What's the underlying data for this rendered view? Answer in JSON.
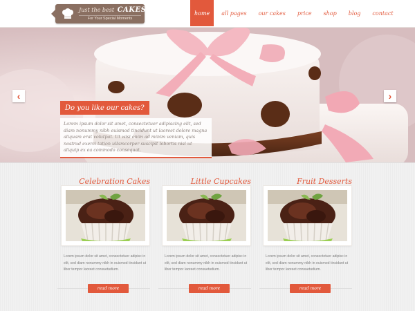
{
  "header": {
    "logo": {
      "tagline_top": "Just the best",
      "brand": "CAKES",
      "tagline_bottom": "For Your Special Moments"
    },
    "nav": [
      {
        "label": "home",
        "active": true
      },
      {
        "label": "all pages",
        "active": false
      },
      {
        "label": "our cakes",
        "active": false
      },
      {
        "label": "price",
        "active": false
      },
      {
        "label": "shop",
        "active": false
      },
      {
        "label": "blog",
        "active": false
      },
      {
        "label": "contact",
        "active": false
      }
    ]
  },
  "hero": {
    "title": "Do you like our cakes?",
    "text": "Lorem ipsum dolor sit amet, consectetuer adipiscing elit, sed diam nonummy nibh euismod tincidunt ut laoreet dolore magna aliquam erat volutpat. Ut wisi enim ad minim veniam, quis nostrud exerci tation ullamcorper suscipit lobortis nisl ut aliquip ex ea commodo consequat.",
    "prev_icon": "chevron-left-icon",
    "next_icon": "chevron-right-icon"
  },
  "features": [
    {
      "title": "Celebration Cakes",
      "text": "Lorem ipsum dolor sit amet, consectetuer adipisc in elit, sed diam nonummy nibh in euismod tincidunt ut liber tempor laoreet consuetudium.",
      "button": "read more"
    },
    {
      "title": "Little Cupcakes",
      "text": "Lorem ipsum dolor sit amet, consectetuer adipisc in elit, sed diam nonummy nibh in euismod tincidunt ut liber tempor laoreet consuetudium.",
      "button": "read more"
    },
    {
      "title": "Fruit Desserts",
      "text": "Lorem ipsum dolor sit amet, consectetuer adipisc in elit, sed diam nonummy nibh in euismod tincidunt ut liber tempor laoreet consuetudium.",
      "button": "read more"
    }
  ],
  "colors": {
    "accent": "#e2593c",
    "logo_bg": "#8a6f61",
    "text_gray": "#7e7e7e"
  }
}
